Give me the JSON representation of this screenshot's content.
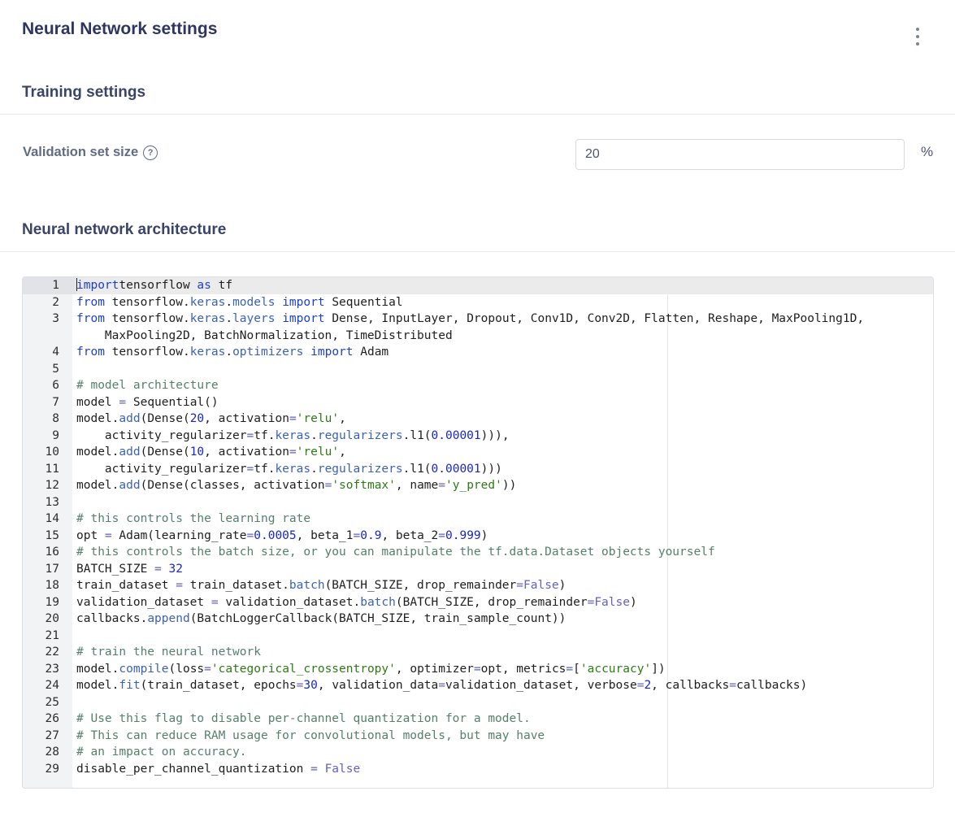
{
  "page_title": "Neural Network settings",
  "menu_icon": "more-vertical-icon",
  "training": {
    "title": "Training settings",
    "validation_label": "Validation set size",
    "help_icon": "question-circle-icon",
    "validation_value": "20",
    "unit": "%"
  },
  "architecture": {
    "title": "Neural network architecture"
  },
  "editor": {
    "active_line": 1,
    "lines": [
      {
        "n": "1",
        "code": [
          [
            "k",
            "import"
          ],
          [
            "",
            "tensorflow "
          ],
          [
            "k",
            "as"
          ],
          [
            "",
            " tf"
          ]
        ]
      },
      {
        "n": "2",
        "code": [
          [
            "k",
            "from"
          ],
          [
            "",
            " tensorflow."
          ],
          [
            "m",
            "keras"
          ],
          [
            "",
            "."
          ],
          [
            "m",
            "models"
          ],
          [
            "",
            " "
          ],
          [
            "k",
            "import"
          ],
          [
            "",
            " Sequential"
          ]
        ]
      },
      {
        "n": "3",
        "code": [
          [
            "k",
            "from"
          ],
          [
            "",
            " tensorflow."
          ],
          [
            "m",
            "keras"
          ],
          [
            "",
            "."
          ],
          [
            "m",
            "layers"
          ],
          [
            "",
            " "
          ],
          [
            "k",
            "import"
          ],
          [
            "",
            " Dense, InputLayer, Dropout, Conv1D, Conv2D, Flatten, Reshape, MaxPooling1D,"
          ]
        ]
      },
      {
        "n": "",
        "code": [
          [
            "",
            "    MaxPooling2D, BatchNormalization, TimeDistributed"
          ]
        ]
      },
      {
        "n": "4",
        "code": [
          [
            "k",
            "from"
          ],
          [
            "",
            " tensorflow."
          ],
          [
            "m",
            "keras"
          ],
          [
            "",
            "."
          ],
          [
            "m",
            "optimizers"
          ],
          [
            "",
            " "
          ],
          [
            "k",
            "import"
          ],
          [
            "",
            " Adam"
          ]
        ]
      },
      {
        "n": "5",
        "code": []
      },
      {
        "n": "6",
        "code": [
          [
            "c",
            "# model architecture"
          ]
        ]
      },
      {
        "n": "7",
        "code": [
          [
            "",
            "model "
          ],
          [
            "o",
            "="
          ],
          [
            "",
            " Sequential()"
          ]
        ]
      },
      {
        "n": "8",
        "code": [
          [
            "",
            "model."
          ],
          [
            "m",
            "add"
          ],
          [
            "",
            "(Dense("
          ],
          [
            "n",
            "20"
          ],
          [
            "",
            ", activation"
          ],
          [
            "o",
            "="
          ],
          [
            "s",
            "'relu'"
          ],
          [
            "",
            ","
          ]
        ]
      },
      {
        "n": "9",
        "code": [
          [
            "",
            "    activity_regularizer"
          ],
          [
            "o",
            "="
          ],
          [
            "",
            "tf."
          ],
          [
            "m",
            "keras"
          ],
          [
            "",
            "."
          ],
          [
            "m",
            "regularizers"
          ],
          [
            "",
            ".l1("
          ],
          [
            "n",
            "0.00001"
          ],
          [
            "",
            "))),"
          ]
        ]
      },
      {
        "n": "10",
        "code": [
          [
            "",
            "model."
          ],
          [
            "m",
            "add"
          ],
          [
            "",
            "(Dense("
          ],
          [
            "n",
            "10"
          ],
          [
            "",
            ", activation"
          ],
          [
            "o",
            "="
          ],
          [
            "s",
            "'relu'"
          ],
          [
            "",
            ","
          ]
        ]
      },
      {
        "n": "11",
        "code": [
          [
            "",
            "    activity_regularizer"
          ],
          [
            "o",
            "="
          ],
          [
            "",
            "tf."
          ],
          [
            "m",
            "keras"
          ],
          [
            "",
            "."
          ],
          [
            "m",
            "regularizers"
          ],
          [
            "",
            ".l1("
          ],
          [
            "n",
            "0.00001"
          ],
          [
            "",
            ")))"
          ]
        ]
      },
      {
        "n": "12",
        "code": [
          [
            "",
            "model."
          ],
          [
            "m",
            "add"
          ],
          [
            "",
            "(Dense(classes, activation"
          ],
          [
            "o",
            "="
          ],
          [
            "s",
            "'softmax'"
          ],
          [
            "",
            ", name"
          ],
          [
            "o",
            "="
          ],
          [
            "s",
            "'y_pred'"
          ],
          [
            "",
            "))"
          ]
        ]
      },
      {
        "n": "13",
        "code": []
      },
      {
        "n": "14",
        "code": [
          [
            "c",
            "# this controls the learning rate"
          ]
        ]
      },
      {
        "n": "15",
        "code": [
          [
            "",
            "opt "
          ],
          [
            "o",
            "="
          ],
          [
            "",
            " Adam(learning_rate"
          ],
          [
            "o",
            "="
          ],
          [
            "n",
            "0.0005"
          ],
          [
            "",
            ", beta_1"
          ],
          [
            "o",
            "="
          ],
          [
            "n",
            "0.9"
          ],
          [
            "",
            ", beta_2"
          ],
          [
            "o",
            "="
          ],
          [
            "n",
            "0.999"
          ],
          [
            "",
            ")"
          ]
        ]
      },
      {
        "n": "16",
        "code": [
          [
            "c",
            "# this controls the batch size, or you can manipulate the tf.data.Dataset objects yourself"
          ]
        ]
      },
      {
        "n": "17",
        "code": [
          [
            "",
            "BATCH_SIZE "
          ],
          [
            "o",
            "="
          ],
          [
            "",
            " "
          ],
          [
            "n",
            "32"
          ]
        ]
      },
      {
        "n": "18",
        "code": [
          [
            "",
            "train_dataset "
          ],
          [
            "o",
            "="
          ],
          [
            "",
            " train_dataset."
          ],
          [
            "m",
            "batch"
          ],
          [
            "",
            "(BATCH_SIZE, drop_remainder"
          ],
          [
            "o",
            "="
          ],
          [
            "o",
            "False"
          ],
          [
            "",
            ")"
          ]
        ]
      },
      {
        "n": "19",
        "code": [
          [
            "",
            "validation_dataset "
          ],
          [
            "o",
            "="
          ],
          [
            "",
            " validation_dataset."
          ],
          [
            "m",
            "batch"
          ],
          [
            "",
            "(BATCH_SIZE, drop_remainder"
          ],
          [
            "o",
            "="
          ],
          [
            "o",
            "False"
          ],
          [
            "",
            ")"
          ]
        ]
      },
      {
        "n": "20",
        "code": [
          [
            "",
            "callbacks."
          ],
          [
            "m",
            "append"
          ],
          [
            "",
            "(BatchLoggerCallback(BATCH_SIZE, train_sample_count))"
          ]
        ]
      },
      {
        "n": "21",
        "code": []
      },
      {
        "n": "22",
        "code": [
          [
            "c",
            "# train the neural network"
          ]
        ]
      },
      {
        "n": "23",
        "code": [
          [
            "",
            "model."
          ],
          [
            "m",
            "compile"
          ],
          [
            "",
            "(loss"
          ],
          [
            "o",
            "="
          ],
          [
            "s",
            "'categorical_crossentropy'"
          ],
          [
            "",
            ", optimizer"
          ],
          [
            "o",
            "="
          ],
          [
            "",
            "opt, metrics"
          ],
          [
            "o",
            "="
          ],
          [
            "",
            "["
          ],
          [
            "s",
            "'accuracy'"
          ],
          [
            "",
            "])"
          ]
        ]
      },
      {
        "n": "24",
        "code": [
          [
            "",
            "model."
          ],
          [
            "m",
            "fit"
          ],
          [
            "",
            "(train_dataset, epochs"
          ],
          [
            "o",
            "="
          ],
          [
            "n",
            "30"
          ],
          [
            "",
            ", validation_data"
          ],
          [
            "o",
            "="
          ],
          [
            "",
            "validation_dataset, verbose"
          ],
          [
            "o",
            "="
          ],
          [
            "n",
            "2"
          ],
          [
            "",
            ", callbacks"
          ],
          [
            "o",
            "="
          ],
          [
            "",
            "callbacks)"
          ]
        ]
      },
      {
        "n": "25",
        "code": []
      },
      {
        "n": "26",
        "code": [
          [
            "c",
            "# Use this flag to disable per-channel quantization for a model."
          ]
        ]
      },
      {
        "n": "27",
        "code": [
          [
            "c",
            "# This can reduce RAM usage for convolutional models, but may have"
          ]
        ]
      },
      {
        "n": "28",
        "code": [
          [
            "c",
            "# an impact on accuracy."
          ]
        ]
      },
      {
        "n": "29",
        "code": [
          [
            "",
            "disable_per_channel_quantization "
          ],
          [
            "o",
            "="
          ],
          [
            "",
            " "
          ],
          [
            "o",
            "False"
          ]
        ]
      }
    ]
  }
}
